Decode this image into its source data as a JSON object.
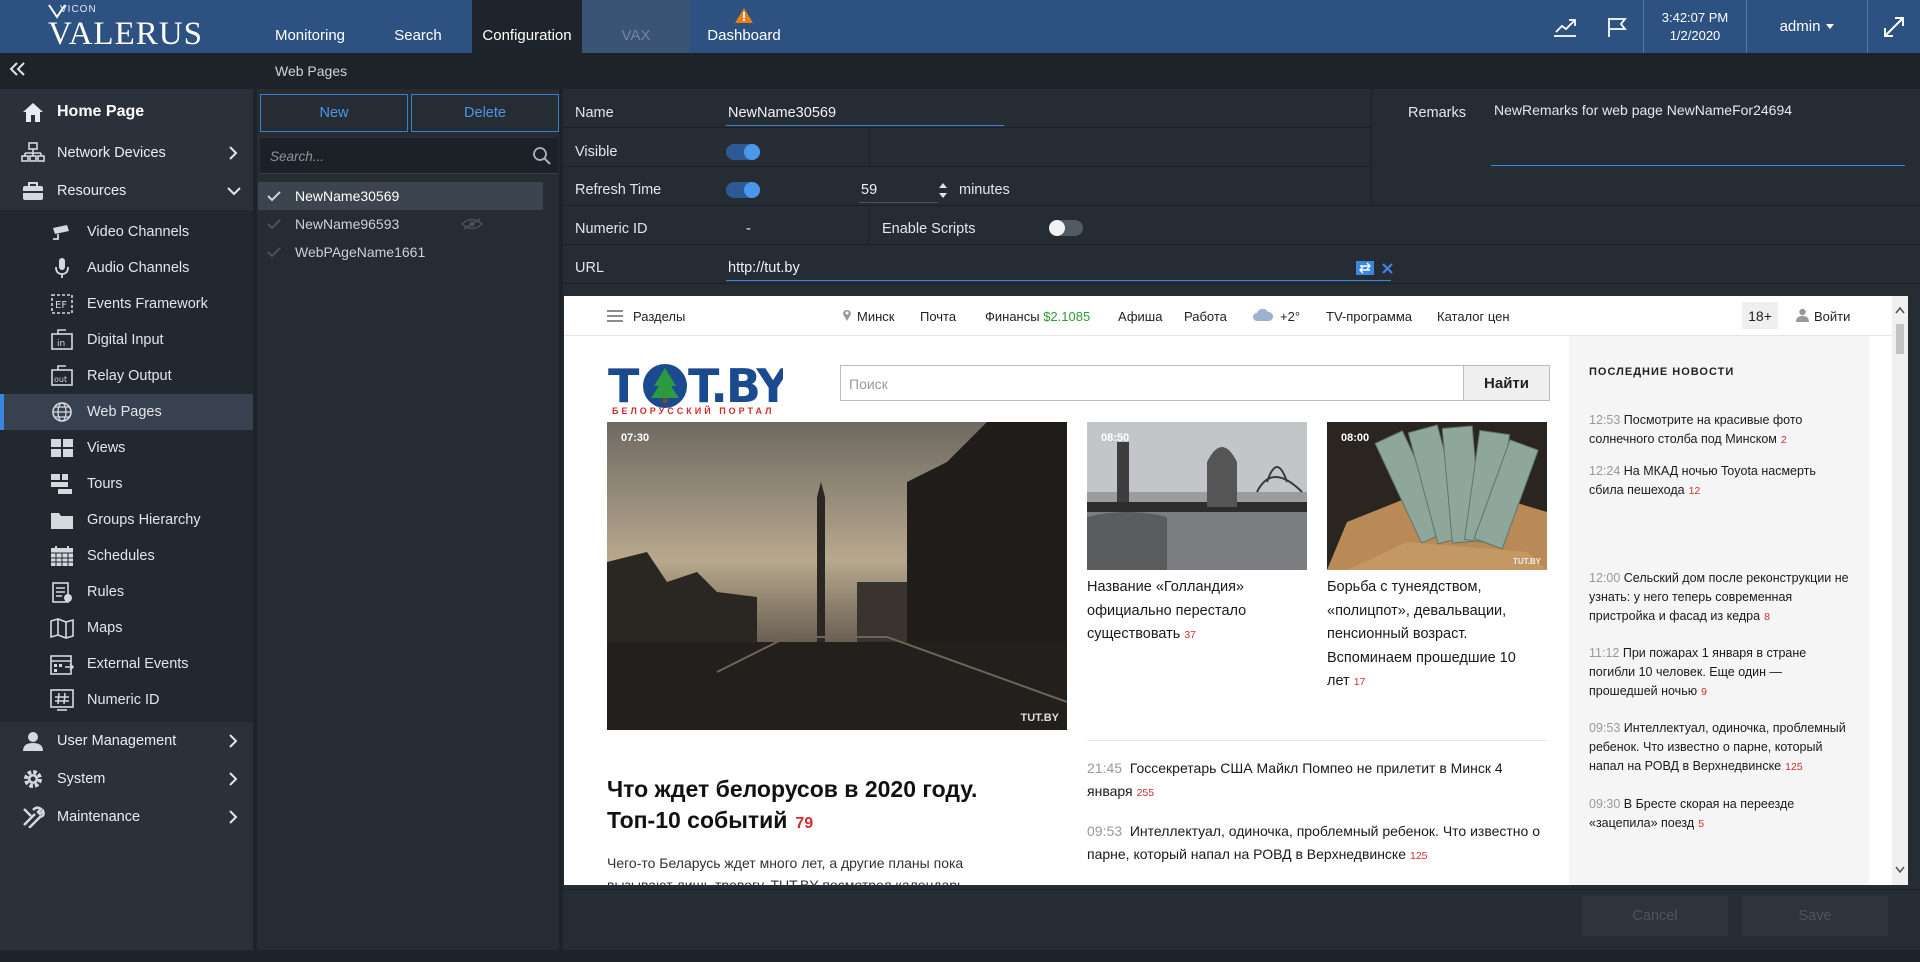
{
  "colors": {
    "topbar": "#2d5282",
    "accent": "#3b86e0",
    "sidebar": "#2b313a",
    "panel": "#262c34"
  },
  "header": {
    "brand": "VICON",
    "app_name": "VALERUS",
    "tabs": [
      {
        "label": "Monitoring"
      },
      {
        "label": "Search"
      },
      {
        "label": "Configuration"
      },
      {
        "label": "VAX"
      },
      {
        "label": "Dashboard"
      }
    ],
    "time": "3:42:07 PM",
    "date": "1/2/2020",
    "user": "admin"
  },
  "breadcrumb": {
    "title": "Web Pages"
  },
  "sidebar": {
    "home": "Home Page",
    "network_devices": "Network Devices",
    "resources": "Resources",
    "items": [
      {
        "label": "Video Channels",
        "icon": "camera-icon"
      },
      {
        "label": "Audio Channels",
        "icon": "microphone-icon"
      },
      {
        "label": "Events Framework",
        "icon": "events-framework-icon"
      },
      {
        "label": "Digital Input",
        "icon": "digital-input-icon"
      },
      {
        "label": "Relay Output",
        "icon": "relay-output-icon"
      },
      {
        "label": "Web Pages",
        "icon": "globe-icon"
      },
      {
        "label": "Views",
        "icon": "views-icon"
      },
      {
        "label": "Tours",
        "icon": "tours-icon"
      },
      {
        "label": "Groups Hierarchy",
        "icon": "folder-icon"
      },
      {
        "label": "Schedules",
        "icon": "calendar-icon"
      },
      {
        "label": "Rules",
        "icon": "rules-icon"
      },
      {
        "label": "Maps",
        "icon": "map-icon"
      },
      {
        "label": "External Events",
        "icon": "external-events-icon"
      },
      {
        "label": "Numeric ID",
        "icon": "hash-icon"
      }
    ],
    "user_management": "User Management",
    "system": "System",
    "maintenance": "Maintenance"
  },
  "list": {
    "new_label": "New",
    "delete_label": "Delete",
    "search_placeholder": "Search...",
    "items": [
      {
        "name": "NewName30569",
        "selected": true
      },
      {
        "name": "NewName96593",
        "selected": false
      },
      {
        "name": "WebPAgeName1661",
        "selected": false
      }
    ]
  },
  "form": {
    "name_label": "Name",
    "name_value": "NewName30569",
    "remarks_label": "Remarks",
    "remarks_value": "NewRemarks for web page NewNameFor24694",
    "visible_label": "Visible",
    "visible_on": true,
    "refresh_label": "Refresh Time",
    "refresh_on": true,
    "refresh_value": "59",
    "refresh_unit": "minutes",
    "numeric_id_label": "Numeric ID",
    "numeric_id_value": "-",
    "enable_scripts_label": "Enable Scripts",
    "enable_scripts_on": false,
    "url_label": "URL",
    "url_value": "http://tut.by",
    "cancel_label": "Cancel",
    "save_label": "Save"
  },
  "webpage": {
    "top": {
      "sections": "Разделы",
      "city": "Минск",
      "mail": "Почта",
      "finance": "Финансы",
      "rate": "$2.1085",
      "afisha": "Афиша",
      "work": "Работа",
      "temp": "+2°",
      "tv": "TV-программа",
      "catalog": "Каталог цен",
      "age": "18+",
      "login": "Войти"
    },
    "logo_sub": "БЕЛОРУССКИЙ ПОРТАЛ",
    "search_placeholder": "Поиск",
    "search_button": "Найти",
    "main_photo_time": "07:30",
    "main_photo_credit": "TUT.BY",
    "main_title": "Что ждет белорусов в 2020 году. Топ-10 событий",
    "main_count": "79",
    "main_text": "Чего-то Беларусь ждет много лет, а другие планы пока вызывают лишь тревогу. TUT.BY посмотрел календарь",
    "card1": {
      "time": "08:50",
      "title": "Название «Голландия» официально перестало существовать",
      "count": "37"
    },
    "card2": {
      "time": "08:00",
      "title": "Борьба с тунеядством, «полицпот», девальвации, пенсионный возраст. Вспоминаем прошедшие 10 лет",
      "count": "17",
      "credit": "TUT.BY"
    },
    "middle_news": [
      {
        "time": "21:45",
        "title": "Госсекретарь США Майкл Помпео не прилетит в Минск 4 января",
        "count": "255"
      },
      {
        "time": "09:53",
        "title": "Интеллектуал, одиночка, проблемный ребенок. Что известно о парне, который напал на РОВД в Верхнедвинске",
        "count": "125"
      }
    ],
    "latest_title": "ПОСЛЕДНИЕ НОВОСТИ",
    "latest": [
      {
        "time": "12:53",
        "title": "Посмотрите на красивые фото солнечного столба под Минском",
        "count": "2"
      },
      {
        "time": "12:24",
        "title": "На МКАД ночью Toyota насмерть сбила пешехода",
        "count": "12"
      },
      {
        "time": "12:00",
        "title": "Сельский дом после реконструкции не узнать: у него теперь современная пристройка и фасад из кедра",
        "count": "8"
      },
      {
        "time": "11:12",
        "title": "При пожарах 1 января в стране погибли 10 человек. Еще один — прошедшей ночью",
        "count": "9"
      },
      {
        "time": "09:53",
        "title": "Интеллектуал, одиночка, проблемный ребенок. Что известно о парне, который напал на РОВД в Верхнедвинске",
        "count": "125"
      },
      {
        "time": "09:30",
        "title": "В Бресте скорая на переезде «зацепила» поезд",
        "count": "5"
      }
    ]
  }
}
